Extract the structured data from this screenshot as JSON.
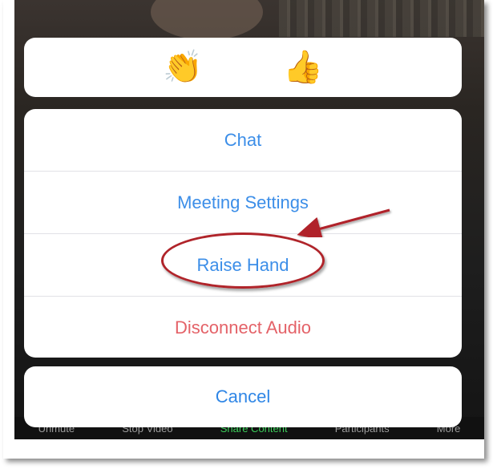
{
  "reactions": {
    "clap": {
      "glyph": "👏",
      "icon": "clapping-hands-icon"
    },
    "thumbs_up": {
      "glyph": "👍",
      "icon": "thumbs-up-icon"
    }
  },
  "menu": {
    "items": [
      {
        "label": "Chat"
      },
      {
        "label": "Meeting Settings"
      },
      {
        "label": "Raise Hand"
      },
      {
        "label": "Disconnect Audio"
      }
    ]
  },
  "cancel_label": "Cancel",
  "toolbar": {
    "items": [
      "Unmute",
      "Stop Video",
      "Share Content",
      "Participants",
      "More"
    ]
  },
  "colors": {
    "action_blue": "#3c8ee8",
    "destructive_red": "#e46268",
    "annotation_red": "#b0242a"
  }
}
